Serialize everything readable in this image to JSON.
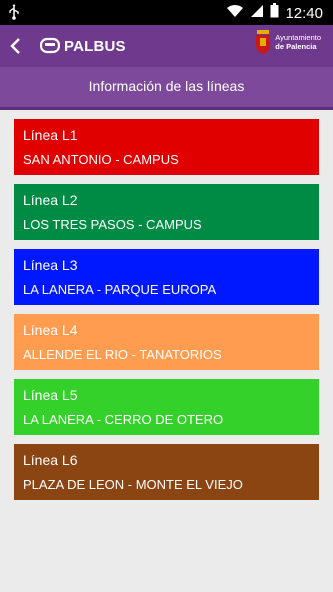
{
  "status_bar": {
    "time": "12:40"
  },
  "app_bar": {
    "logo_text": "PALBUS",
    "municipality_line1": "Ayuntamiento",
    "municipality_line2": "de Palencia"
  },
  "header": {
    "title": "Información de las líneas"
  },
  "lines": [
    {
      "name": "Línea L1",
      "route": "SAN ANTONIO - CAMPUS",
      "color": "#e00000"
    },
    {
      "name": "Línea L2",
      "route": "LOS TRES PASOS - CAMPUS",
      "color": "#008b45"
    },
    {
      "name": "Línea L3",
      "route": "LA LANERA - PARQUE EUROPA",
      "color": "#0018ff"
    },
    {
      "name": "Línea L4",
      "route": "ALLENDE EL RIO - TANATORIOS",
      "color": "#ff9c50"
    },
    {
      "name": "Línea L5",
      "route": "LA LANERA - CERRO DE OTERO",
      "color": "#33d12a"
    },
    {
      "name": "Línea L6",
      "route": "PLAZA DE LEON - MONTE EL VIEJO",
      "color": "#8b4513"
    }
  ],
  "colors": {
    "app_bar": "#6f3a8e",
    "sub_bar": "#7d4a9b",
    "background": "#ebebeb"
  }
}
